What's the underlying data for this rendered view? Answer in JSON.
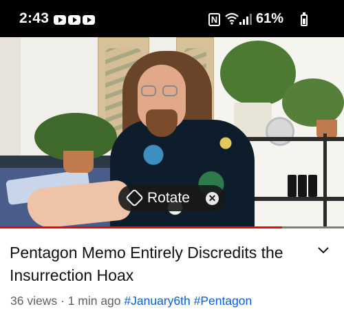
{
  "status_bar": {
    "time": "2:43",
    "notification_icons": [
      "youtube-icon",
      "youtube-icon",
      "youtube-icon"
    ],
    "nfc_label": "N",
    "battery": "61%"
  },
  "player": {
    "rotate_label": "Rotate",
    "progress_fraction": 0.82,
    "accent_color": "#ff0000"
  },
  "video": {
    "title": "Pentagon Memo Entirely Discredits the Insurrection Hoax",
    "views": "36 views",
    "separator": "·",
    "age": "1 min ago",
    "hashtags": [
      "#January6th",
      "#Pentagon"
    ]
  }
}
